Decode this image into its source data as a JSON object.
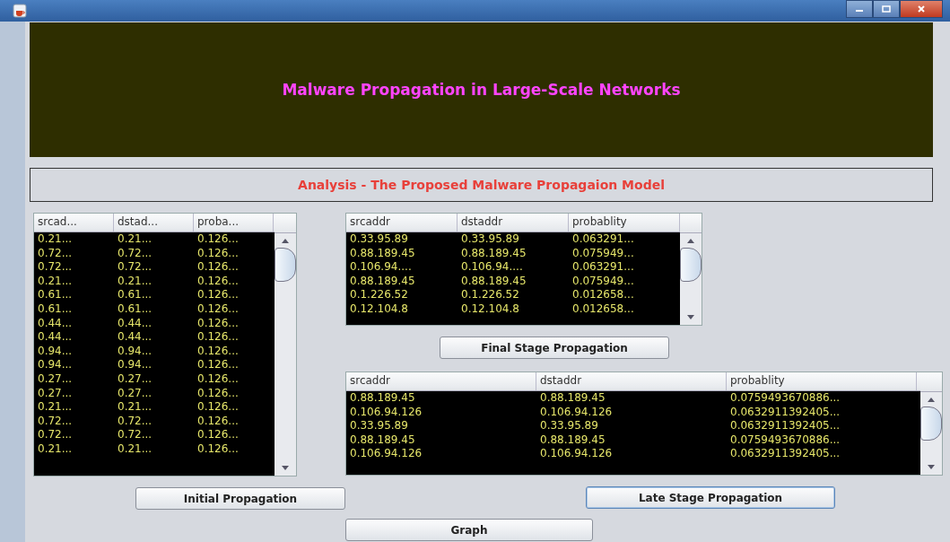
{
  "banner": {
    "title": "Malware Propagation in Large-Scale Networks"
  },
  "subtitle": "Analysis - The Proposed Malware Propagaion Model",
  "initial_table": {
    "columns": [
      "srcad...",
      "dstad...",
      "proba..."
    ],
    "rows": [
      [
        "0.21...",
        "0.21...",
        "0.126..."
      ],
      [
        "0.72...",
        "0.72...",
        "0.126..."
      ],
      [
        "0.72...",
        "0.72...",
        "0.126..."
      ],
      [
        "0.21...",
        "0.21...",
        "0.126..."
      ],
      [
        "0.61...",
        "0.61...",
        "0.126..."
      ],
      [
        "0.61...",
        "0.61...",
        "0.126..."
      ],
      [
        "0.44...",
        "0.44...",
        "0.126..."
      ],
      [
        "0.44...",
        "0.44...",
        "0.126..."
      ],
      [
        "0.94...",
        "0.94...",
        "0.126..."
      ],
      [
        "0.94...",
        "0.94...",
        "0.126..."
      ],
      [
        "0.27...",
        "0.27...",
        "0.126..."
      ],
      [
        "0.27...",
        "0.27...",
        "0.126..."
      ],
      [
        "0.21...",
        "0.21...",
        "0.126..."
      ],
      [
        "0.72...",
        "0.72...",
        "0.126..."
      ],
      [
        "0.72...",
        "0.72...",
        "0.126..."
      ],
      [
        "0.21...",
        "0.21...",
        "0.126..."
      ]
    ]
  },
  "final_table": {
    "columns": [
      "srcaddr",
      "dstaddr",
      "probablity"
    ],
    "rows": [
      [
        "0.33.95.89",
        "0.33.95.89",
        "0.063291..."
      ],
      [
        "0.88.189.45",
        "0.88.189.45",
        "0.075949..."
      ],
      [
        "0.106.94....",
        "0.106.94....",
        "0.063291..."
      ],
      [
        "0.88.189.45",
        "0.88.189.45",
        "0.075949..."
      ],
      [
        "0.1.226.52",
        "0.1.226.52",
        "0.012658..."
      ],
      [
        "0.12.104.8",
        "0.12.104.8",
        "0.012658..."
      ]
    ]
  },
  "final_button": "Final Stage Propagation",
  "late_table": {
    "columns": [
      "srcaddr",
      "dstaddr",
      "probablity"
    ],
    "rows": [
      [
        "0.88.189.45",
        "0.88.189.45",
        "0.0759493670886..."
      ],
      [
        "0.106.94.126",
        "0.106.94.126",
        "0.0632911392405..."
      ],
      [
        "0.33.95.89",
        "0.33.95.89",
        "0.0632911392405..."
      ],
      [
        "0.88.189.45",
        "0.88.189.45",
        "0.0759493670886..."
      ],
      [
        "0.106.94.126",
        "0.106.94.126",
        "0.0632911392405..."
      ]
    ]
  },
  "buttons": [
    {
      "label": "Initial Propagation",
      "kind": "initial",
      "selected": false
    },
    {
      "label": "Late Stage Propagation",
      "kind": "late",
      "selected": true
    },
    {
      "label": "Graph",
      "kind": "graph",
      "selected": false
    }
  ]
}
